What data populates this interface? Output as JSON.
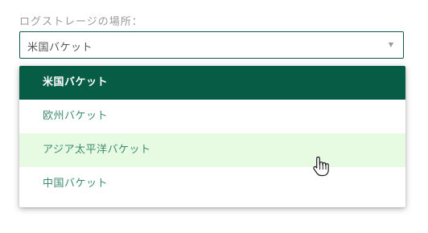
{
  "storage": {
    "label": "ログストレージの場所：",
    "selected_value": "米国バケット"
  },
  "dropdown": {
    "options": [
      {
        "label": "米国バケット",
        "state": "selected"
      },
      {
        "label": "欧州バケット",
        "state": "normal"
      },
      {
        "label": "アジア太平洋バケット",
        "state": "hovered"
      },
      {
        "label": "中国バケット",
        "state": "normal"
      }
    ]
  },
  "colors": {
    "accent": "#075c45",
    "option_text": "#3d8a72",
    "hover_bg": "#e6fbe2"
  },
  "icons": {
    "caret": "caret-down-icon",
    "cursor": "hand-pointer-cursor"
  }
}
